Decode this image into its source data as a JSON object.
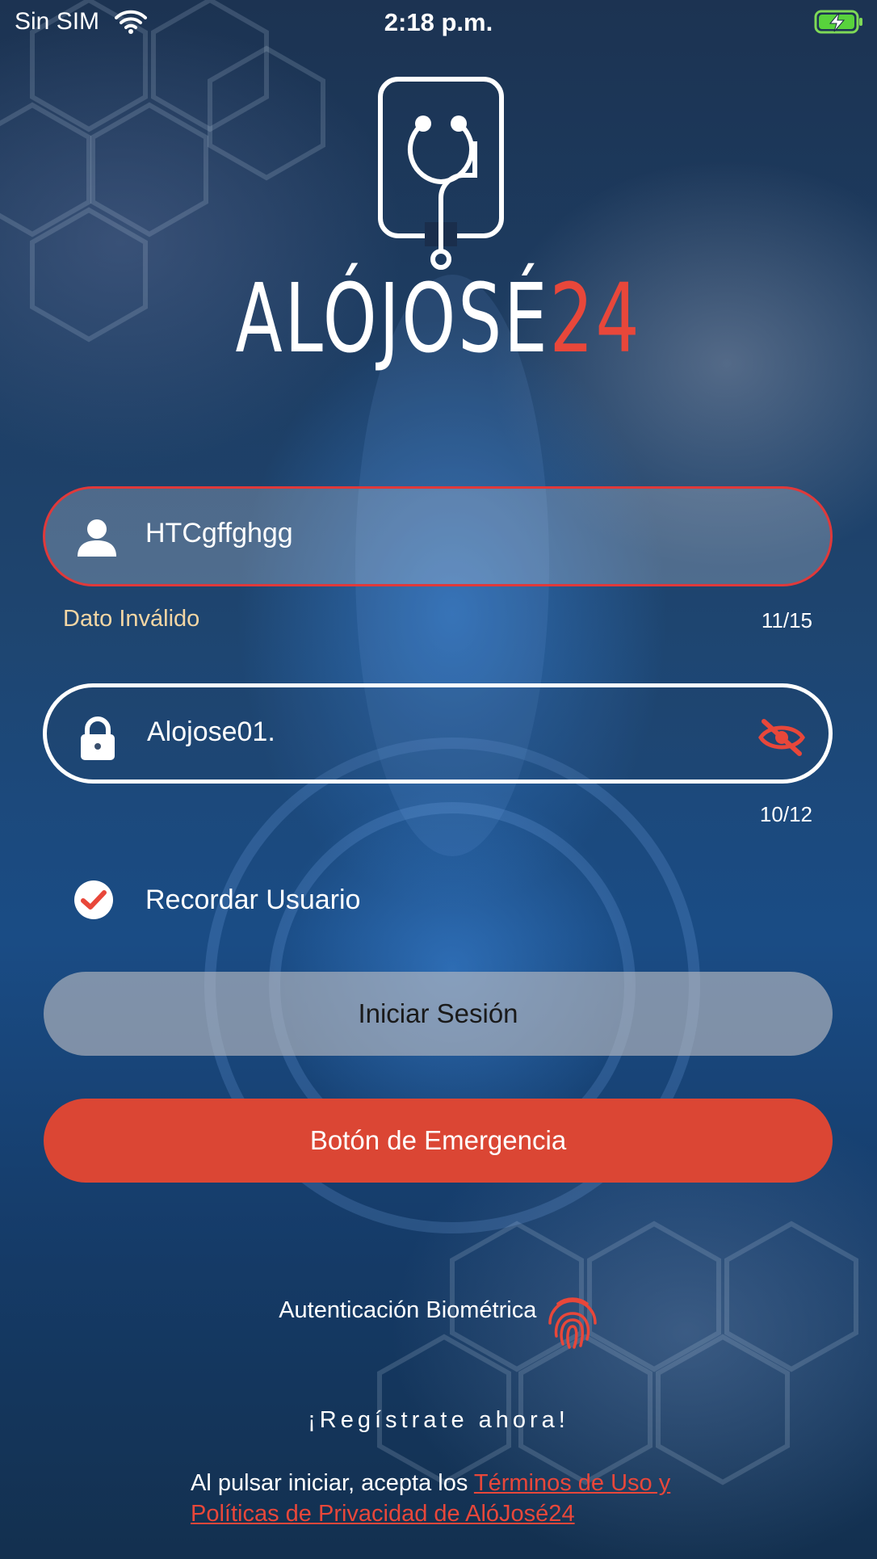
{
  "status_bar": {
    "carrier": "Sin SIM",
    "time": "2:18 p.m."
  },
  "logo": {
    "text_main": "ALÓJOSÉ",
    "text_accent": "24"
  },
  "username_field": {
    "value": "HTCgffghgg",
    "error": "Dato Inválido",
    "counter": "11/15"
  },
  "password_field": {
    "value": "Alojose01.",
    "counter": "10/12"
  },
  "remember": {
    "label": "Recordar Usuario",
    "checked": true
  },
  "buttons": {
    "login": "Iniciar Sesión",
    "emergency": "Botón de Emergencia"
  },
  "biometric": {
    "label": "Autenticación Biométrica"
  },
  "register": {
    "label": "¡Regístrate ahora!"
  },
  "terms": {
    "prefix": "Al pulsar iniciar, acepta los ",
    "link": "Términos de Uso y Políticas de Privacidad de AlóJosé24"
  },
  "colors": {
    "accent": "#e8473a",
    "emergency": "#db4634",
    "error_border": "#e0393a",
    "error_text": "#f3d6a4"
  }
}
